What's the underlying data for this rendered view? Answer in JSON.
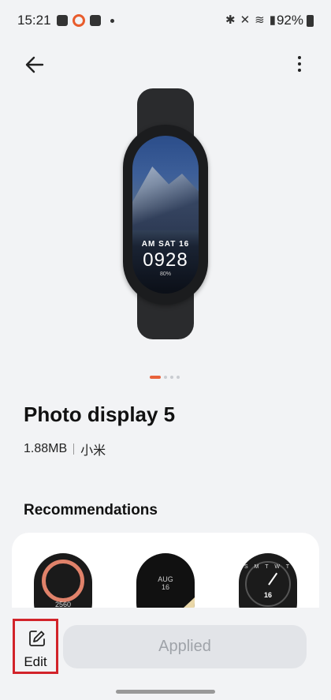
{
  "status": {
    "time": "15:21",
    "battery": "92%"
  },
  "watch": {
    "date": "AM SAT 16",
    "time": "0928",
    "battery": "80%"
  },
  "title": "Photo display 5",
  "meta": {
    "size": "1.88MB",
    "author": "小米"
  },
  "recommendations": {
    "heading": "Recommendations",
    "face1_num": "2560",
    "face2_month": "AUG",
    "face2_day": "16",
    "face3_letters": "S M T W T",
    "face3_day": "16"
  },
  "bottom": {
    "edit_label": "Edit",
    "applied_label": "Applied"
  },
  "colors": {
    "accent": "#e8623a",
    "highlight": "#d2232a"
  },
  "icons": [
    "back-arrow-icon",
    "more-vert-icon",
    "edit-icon"
  ]
}
